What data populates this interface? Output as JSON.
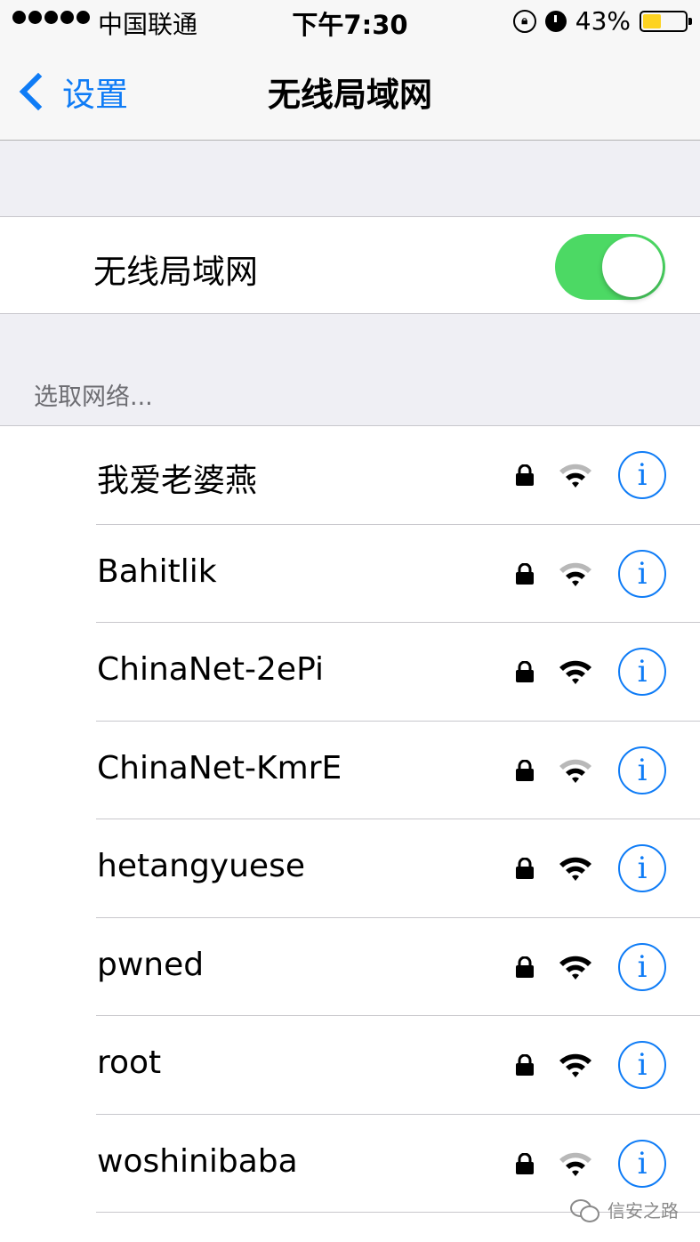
{
  "status_bar": {
    "carrier": "中国联通",
    "time": "下午7:30",
    "battery_percent": "43%",
    "battery_level": 0.43,
    "signal_dots": 5,
    "icons": [
      "rotation-lock-icon",
      "alarm-icon",
      "battery-icon"
    ]
  },
  "nav": {
    "back_label": "设置",
    "title": "无线局域网"
  },
  "wifi_toggle": {
    "label": "无线局域网",
    "on": true,
    "color": "#4cd964"
  },
  "network_section": {
    "header": "选取网络..."
  },
  "networks": [
    {
      "ssid": "我爱老婆燕",
      "secured": true,
      "strength": 2
    },
    {
      "ssid": "Bahitlik",
      "secured": true,
      "strength": 2
    },
    {
      "ssid": "ChinaNet-2ePi",
      "secured": true,
      "strength": 3
    },
    {
      "ssid": "ChinaNet-KmrE",
      "secured": true,
      "strength": 2
    },
    {
      "ssid": "hetangyuese",
      "secured": true,
      "strength": 3
    },
    {
      "ssid": "pwned",
      "secured": true,
      "strength": 3
    },
    {
      "ssid": "root",
      "secured": true,
      "strength": 3
    },
    {
      "ssid": "woshinibaba",
      "secured": true,
      "strength": 2
    }
  ],
  "watermark": {
    "text": "信安之路"
  },
  "colors": {
    "accent": "#0f7cf6",
    "toggle_on": "#4cd964",
    "background": "#efeff4",
    "battery": "#fdd321"
  }
}
